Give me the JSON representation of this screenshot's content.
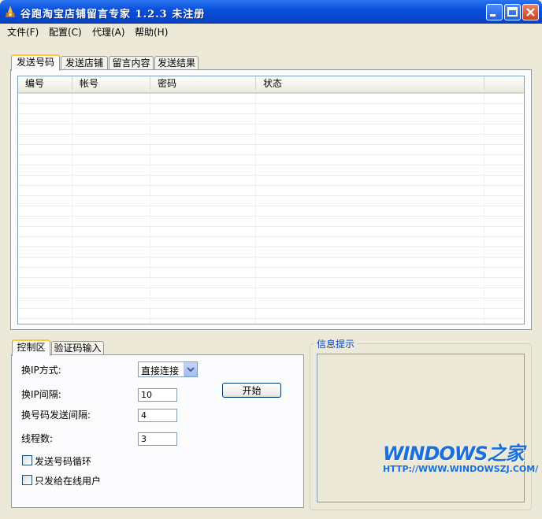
{
  "window": {
    "title": "谷跑淘宝店铺留言专家 1.2.3 未注册"
  },
  "menu": [
    "文件(F)",
    "配置(C)",
    "代理(A)",
    "帮助(H)"
  ],
  "top_tabs": [
    "发送号码",
    "发送店铺",
    "留言内容",
    "发送结果"
  ],
  "table": {
    "columns": [
      "编号",
      "帐号",
      "密码",
      "状态"
    ]
  },
  "bottom_tabs": [
    "控制区",
    "验证码输入"
  ],
  "controls": {
    "ip_mode_label": "换IP方式:",
    "ip_mode_value": "直接连接",
    "ip_interval_label": "换IP间隔:",
    "ip_interval_value": "10",
    "send_interval_label": "换号码发送间隔:",
    "send_interval_value": "4",
    "threads_label": "线程数:",
    "threads_value": "3",
    "start_button": "开始",
    "loop_label": "发送号码循环",
    "online_only_label": "只发给在线用户"
  },
  "info": {
    "title": "信息提示"
  },
  "watermark": {
    "logo": "WINDOWS之家",
    "url": "HTTP://WWW.WINDOWSZJ.COM/"
  }
}
